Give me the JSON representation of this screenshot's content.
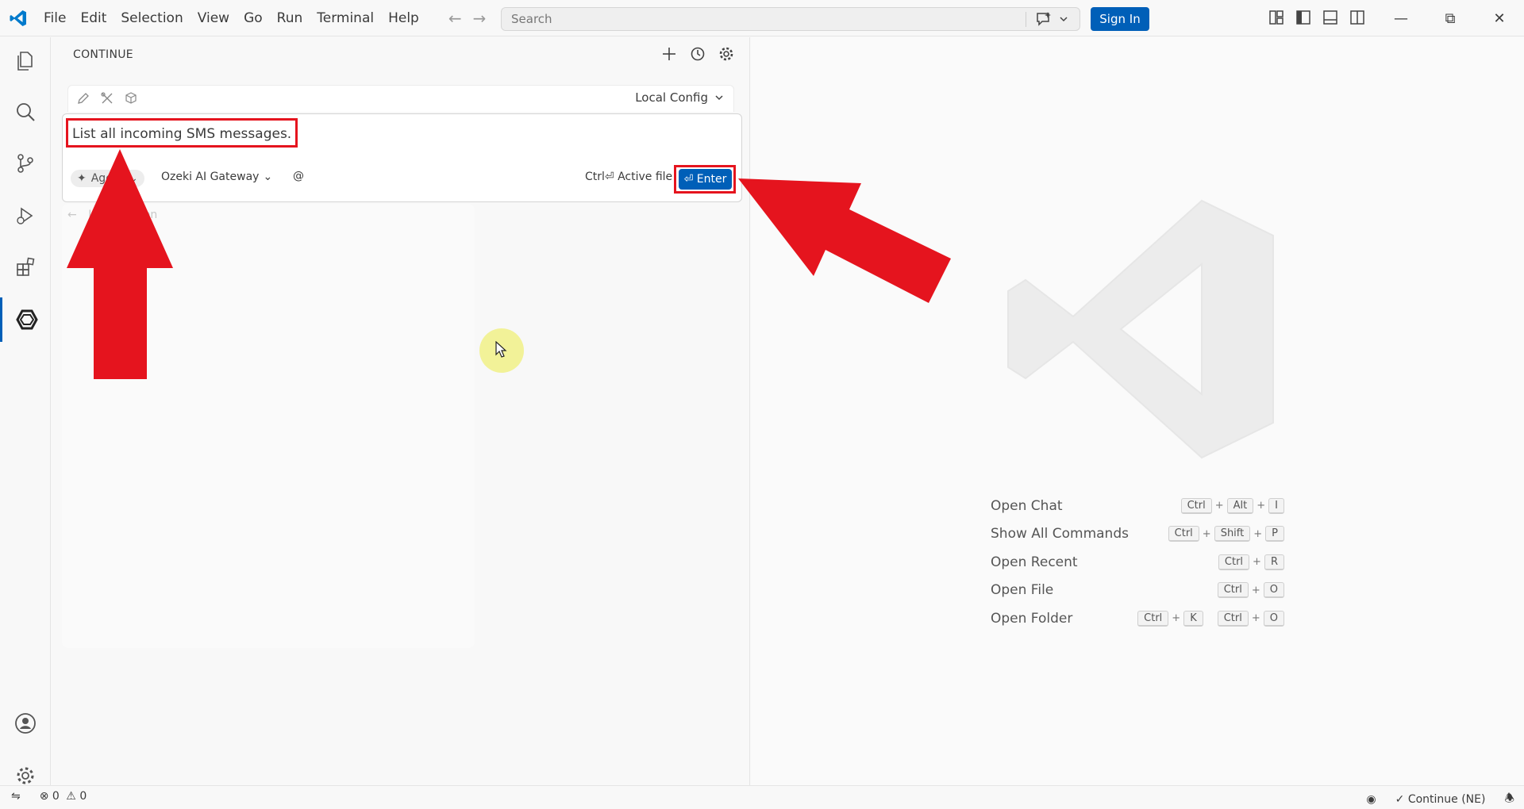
{
  "titlebar": {
    "menu": [
      "File",
      "Edit",
      "Selection",
      "View",
      "Go",
      "Run",
      "Terminal",
      "Help"
    ],
    "search_placeholder": "Search",
    "signin_label": "Sign In"
  },
  "sidebar": {
    "title": "CONTINUE",
    "config_label": "Local Config",
    "prompt_text": "List all incoming SMS messages.",
    "mode_label": "Agent",
    "model_label": "Ozeki AI Gateway",
    "at_label": "@",
    "active_file_label": "Ctrl⏎ Active file",
    "enter_label": "⏎ Enter",
    "back_label": "Last Session"
  },
  "editor": {
    "shortcuts": [
      {
        "label": "Open Chat",
        "keys": [
          [
            "Ctrl",
            "Alt",
            "I"
          ]
        ]
      },
      {
        "label": "Show All Commands",
        "keys": [
          [
            "Ctrl",
            "Shift",
            "P"
          ]
        ]
      },
      {
        "label": "Open Recent",
        "keys": [
          [
            "Ctrl",
            "R"
          ]
        ]
      },
      {
        "label": "Open File",
        "keys": [
          [
            "Ctrl",
            "O"
          ]
        ]
      },
      {
        "label": "Open Folder",
        "keys": [
          [
            "Ctrl",
            "K"
          ],
          [
            "Ctrl",
            "O"
          ]
        ]
      }
    ]
  },
  "statusbar": {
    "errors": "0",
    "warnings": "0",
    "continue_label": "Continue (NE)"
  },
  "colors": {
    "accent": "#005fb8",
    "annotation_red": "#e5141e"
  }
}
